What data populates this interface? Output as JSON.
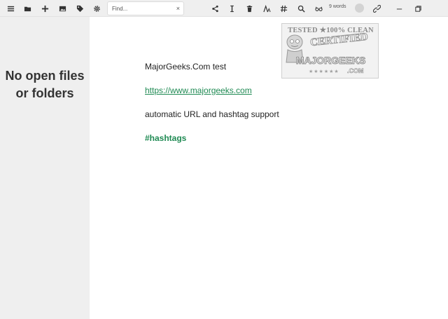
{
  "toolbar": {
    "left_icons": [
      "menu-icon",
      "folder-open-icon",
      "plus-icon",
      "image-icon",
      "tag-icon",
      "gear-icon"
    ],
    "search": {
      "placeholder": "Find...",
      "value": "",
      "clear_glyph": "×"
    },
    "right_icons": [
      "share-icon",
      "text-cursor-icon",
      "trash-icon",
      "text-size-icon",
      "hashtag-icon",
      "search-icon",
      "reading-glasses-icon"
    ],
    "word_count": "9 words",
    "trailing_icons": [
      "link-icon",
      "minimize-icon",
      "restore-icon"
    ]
  },
  "sidebar": {
    "empty_message": "No open files or folders"
  },
  "document": {
    "line1": "MajorGeeks.Com test",
    "link": "https://www.majorgeeks.com",
    "line3": "automatic URL and hashtag support",
    "hashtag": "#hashtags"
  },
  "watermark": {
    "top": "TESTED ★100% CLEAN",
    "certified": "CERTIFIED",
    "brand": "MAJORGEEKS",
    "stars": "★★★★★★",
    "com": ".COM"
  },
  "colors": {
    "accent_green": "#1f8a53",
    "sidebar_bg": "#efefef",
    "toolbar_bg": "#efefef"
  }
}
